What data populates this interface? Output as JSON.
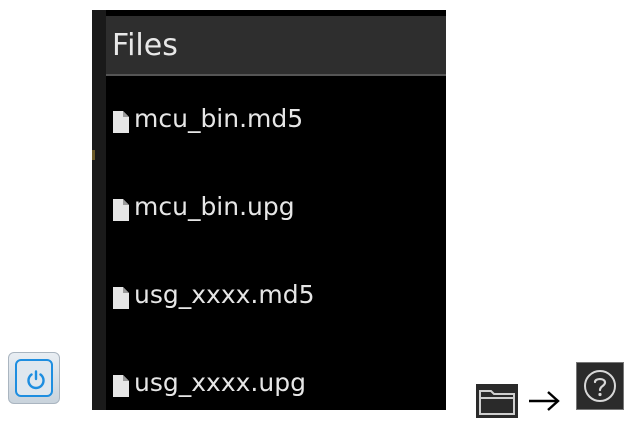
{
  "power_button": {
    "icon": "power-icon",
    "accent": "#1e8ee0"
  },
  "file_browser": {
    "header": "Files",
    "files": [
      {
        "name": "mcu_bin.md5",
        "icon": "file-icon"
      },
      {
        "name": "mcu_bin.upg",
        "icon": "file-icon"
      },
      {
        "name": "usg_xxxx.md5",
        "icon": "file-icon"
      },
      {
        "name": "usg_xxxx.upg",
        "icon": "file-icon"
      }
    ]
  },
  "navigation": {
    "from_icon": "folder-icon",
    "arrow": "arrow-right-icon",
    "to_icon": "help-icon"
  }
}
